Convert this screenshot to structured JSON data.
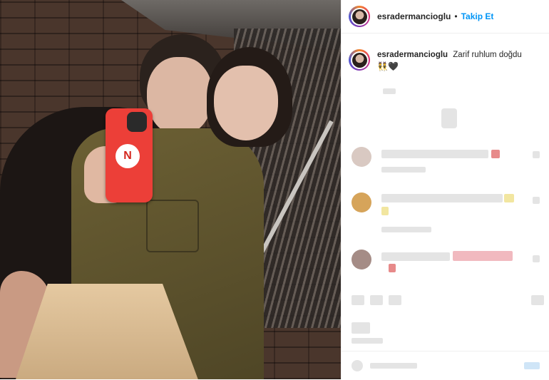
{
  "post": {
    "header": {
      "username": "esradermancioglu",
      "separator": "•",
      "follow_label": "Takip Et"
    },
    "caption": {
      "username": "esradermancioglu",
      "text": "Zarif ruhlum doğdu",
      "emojis": "👯🖤"
    },
    "photo": {
      "phone_badge": "N"
    }
  }
}
